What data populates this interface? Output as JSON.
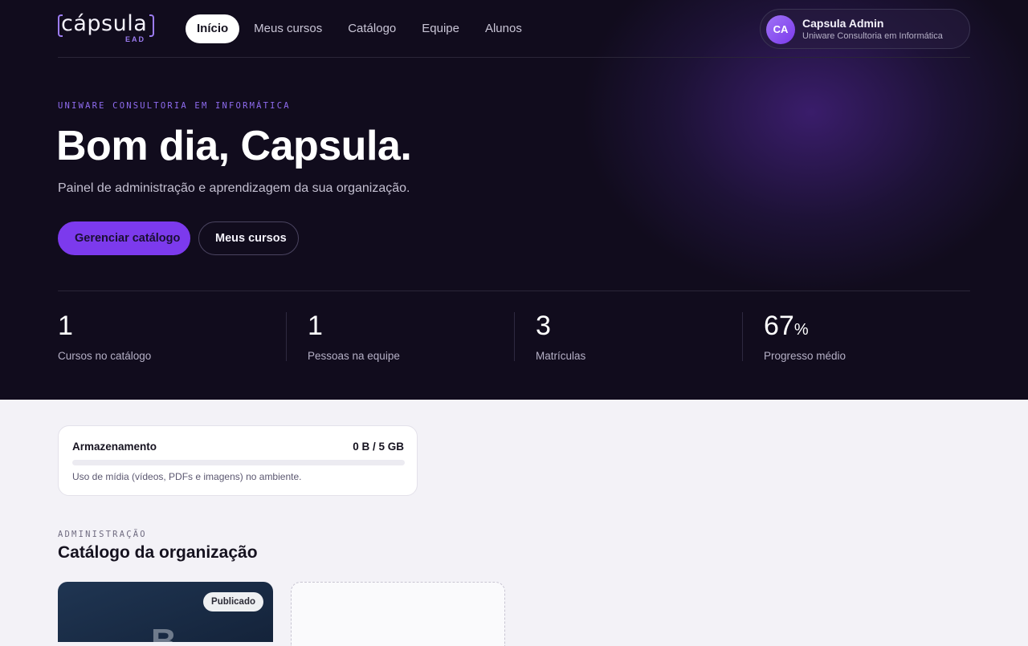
{
  "brand": {
    "logo_text": "cápsula",
    "logo_sub": "EAD",
    "accent": "#7c3aed"
  },
  "nav": {
    "items": [
      {
        "label": "Início",
        "active": true
      },
      {
        "label": "Meus cursos",
        "active": false
      },
      {
        "label": "Catálogo",
        "active": false
      },
      {
        "label": "Equipe",
        "active": false
      },
      {
        "label": "Alunos",
        "active": false
      }
    ]
  },
  "user": {
    "initials": "CA",
    "name": "Capsula Admin",
    "org": "Uniware Consultoria em Informática"
  },
  "hero": {
    "eyebrow": "UNIWARE CONSULTORIA EM INFORMÁTICA",
    "greeting": "Bom dia, Capsula.",
    "subtitle": "Painel de administração e aprendizagem da sua organização.",
    "primary_button": "Gerenciar catálogo",
    "secondary_button": "Meus cursos"
  },
  "stats": [
    {
      "value": "1",
      "unit": "",
      "label": "Cursos no catálogo"
    },
    {
      "value": "1",
      "unit": "",
      "label": "Pessoas na equipe"
    },
    {
      "value": "3",
      "unit": "",
      "label": "Matrículas"
    },
    {
      "value": "67",
      "unit": "%",
      "label": "Progresso médio"
    }
  ],
  "storage": {
    "title": "Armazenamento",
    "value": "0 B / 5 GB",
    "used_fraction": 0,
    "note": "Uso de mídia (vídeos, PDFs e imagens) no ambiente."
  },
  "admin_section": {
    "eyebrow": "ADMINISTRAÇÃO",
    "title": "Catálogo da organização",
    "course": {
      "status": "Publicado",
      "initial": "B"
    }
  }
}
